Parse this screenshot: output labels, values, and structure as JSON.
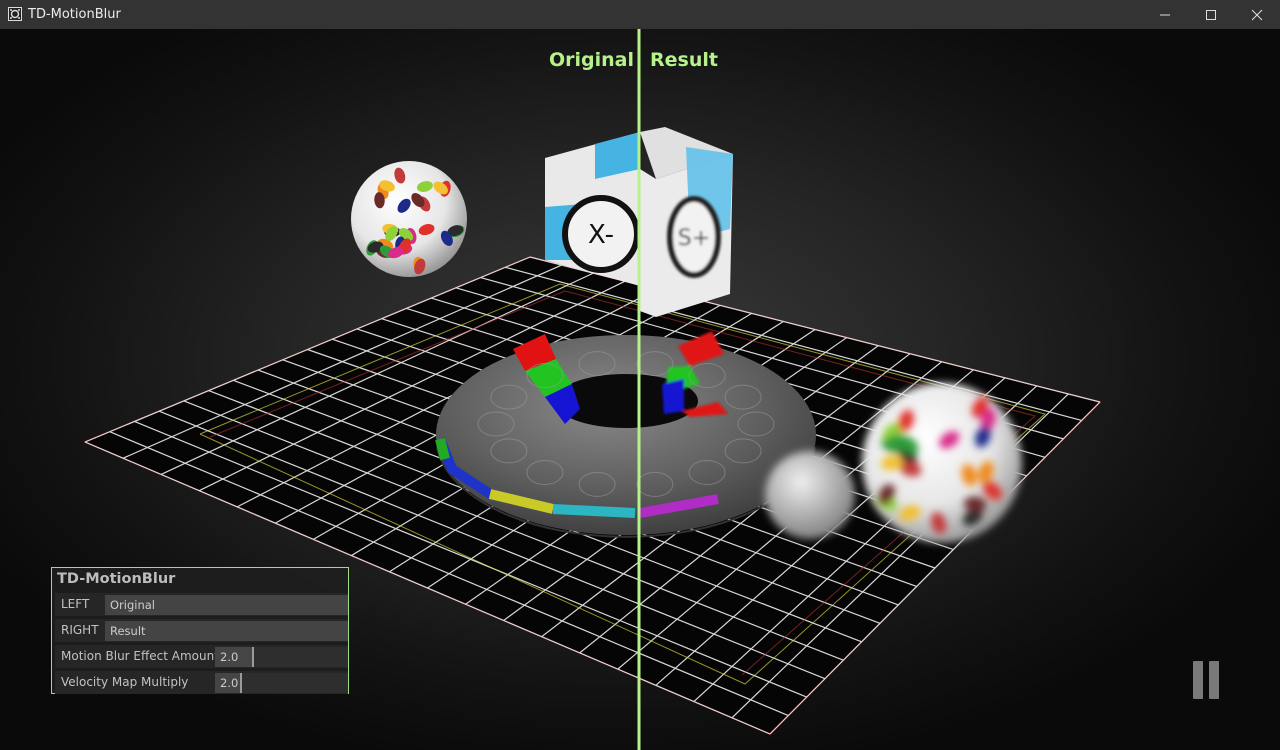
{
  "window": {
    "title": "TD-MotionBlur"
  },
  "split": {
    "left_label": "Original",
    "right_label": "Result"
  },
  "panel": {
    "title": "TD-MotionBlur",
    "left": {
      "label": "LEFT",
      "value": "Original"
    },
    "right": {
      "label": "RIGHT",
      "value": "Result"
    },
    "blur_amount": {
      "label": "Motion Blur Effect Amount",
      "value": "2.0",
      "level": 0.28
    },
    "velocity_multiply": {
      "label": "Velocity Map Multiply",
      "value": "2.0",
      "level": 0.19
    }
  },
  "colors": {
    "accent": "#b6f28a",
    "panel_border": "#9fdc7c",
    "titlebar": "#333333"
  },
  "icons": {
    "app": "touchdesigner-icon",
    "pause": "pause-icon",
    "minimize": "minimize-icon",
    "maximize": "maximize-icon",
    "close": "close-icon"
  }
}
